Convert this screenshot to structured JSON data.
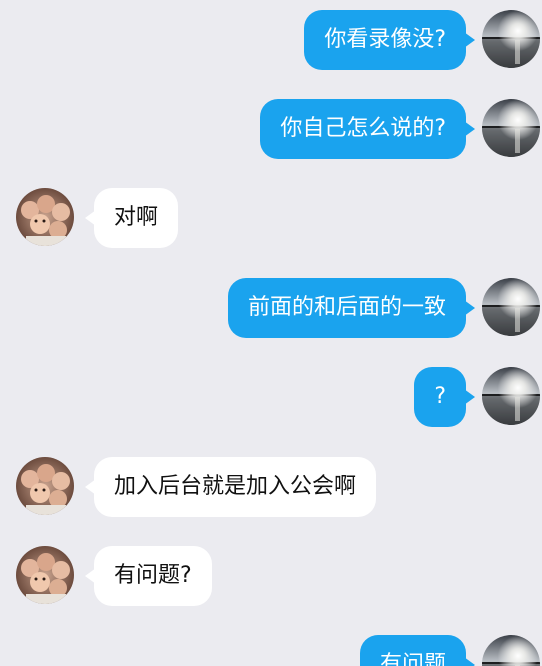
{
  "colors": {
    "background": "#ebebf0",
    "outgoing_bubble": "#1aa3ee",
    "incoming_bubble": "#ffffff"
  },
  "messages": [
    {
      "side": "outgoing",
      "text": "你看录像没?",
      "avatar": "sunset-lake-avatar"
    },
    {
      "side": "outgoing",
      "text": "你自己怎么说的?",
      "avatar": "sunset-lake-avatar"
    },
    {
      "side": "incoming",
      "text": "对啊",
      "avatar": "group-selfie-avatar"
    },
    {
      "side": "outgoing",
      "text": "前面的和后面的一致",
      "avatar": "sunset-lake-avatar"
    },
    {
      "side": "outgoing",
      "text": "?",
      "avatar": "sunset-lake-avatar"
    },
    {
      "side": "incoming",
      "text": "加入后台就是加入公会啊",
      "avatar": "group-selfie-avatar"
    },
    {
      "side": "incoming",
      "text": "有问题?",
      "avatar": "group-selfie-avatar"
    },
    {
      "side": "outgoing",
      "text": "有问题",
      "avatar": "sunset-lake-avatar"
    }
  ]
}
